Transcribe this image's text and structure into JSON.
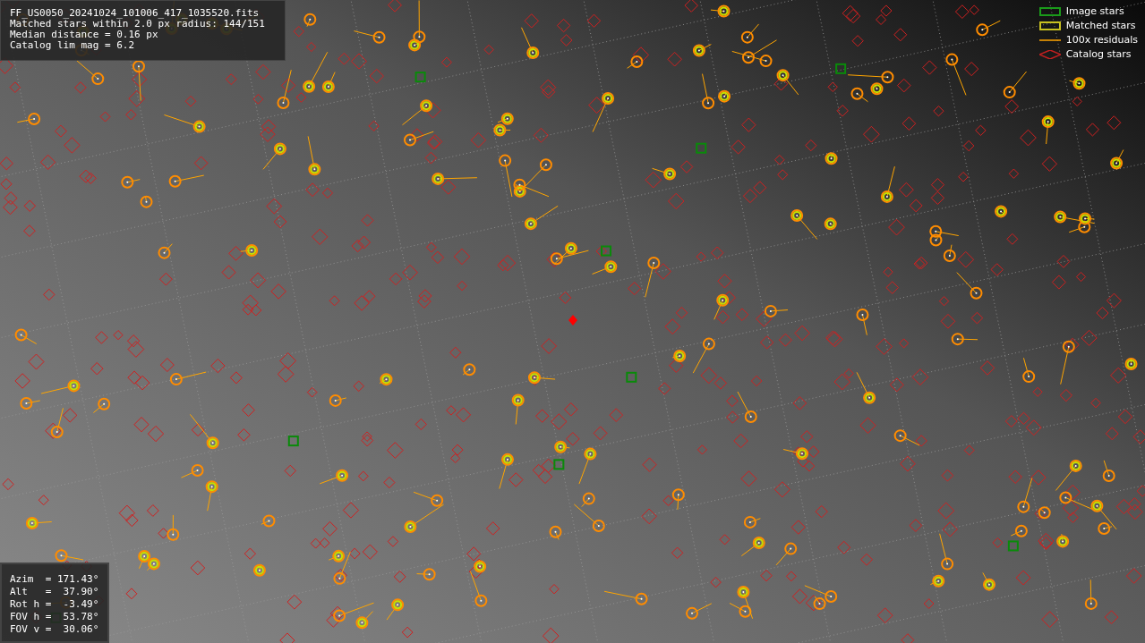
{
  "info_panel": {
    "lines": [
      "FF_US0050_20241024_101006_417_1035520.fits",
      "Matched stars within 2.0 px radius: 144/151",
      "Median distance = 0.16 px",
      "Catalog lim mag = 6.2"
    ]
  },
  "legend": [
    {
      "kind": "image",
      "label": "Image stars"
    },
    {
      "kind": "matched",
      "label": "Matched stars"
    },
    {
      "kind": "residual",
      "label": "100x residuals"
    },
    {
      "kind": "catalog",
      "label": "Catalog stars"
    }
  ],
  "pointing_panel": {
    "lines": [
      "Azim  = 171.43°",
      "Alt   =  37.90°",
      "Rot h =  -3.49°",
      "FOV h =  53.78°",
      "FOV v =  30.06°"
    ]
  }
}
